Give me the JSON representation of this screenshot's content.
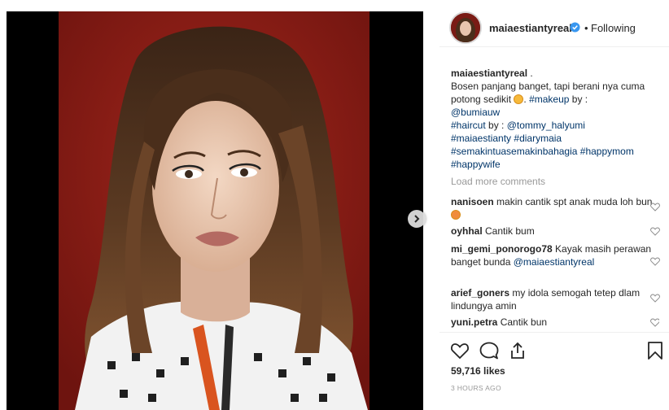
{
  "header": {
    "username": "maiaestiantyreal",
    "dot": "•",
    "follow_status": "Following"
  },
  "caption": {
    "username": "maiaestiantyreal",
    "text_1": " .",
    "line_2": "Bosen panjang banget, tapi berani nya cuma potong sedikit ",
    "line_2b": ". ",
    "tag_makeup": "#makeup",
    "by_1": " by :",
    "mention_1": "@bumiauw",
    "tag_haircut": "#haircut",
    "by_2": " by : ",
    "mention_2": "@tommy_halyumi",
    "tag_3": "#maiaestianty",
    "tag_4": "#diarymaia",
    "tag_5": "#semakintuasemakinbahagia",
    "tag_6": "#happymom",
    "tag_7": "#happywife"
  },
  "load_more": "Load more comments",
  "comments": [
    {
      "user": "nanisoen",
      "text": " makin cantik spt anak muda loh bun"
    },
    {
      "user": "oyhhal",
      "text": " Cantik bum"
    },
    {
      "user": "mi_gemi_ponorogo78",
      "text": " Kayak masih perawan banget bunda ",
      "mention": "@maiaestiantyreal"
    },
    {
      "user": "arief_goners",
      "text": " my idola semogah tetep dlam lindungya amin"
    },
    {
      "user": "yuni.petra",
      "text": " Cantik bun"
    }
  ],
  "likes": "59,716 likes",
  "time": "3 HOURS AGO",
  "icons": {
    "like": "heart-icon",
    "comment": "comment-icon",
    "share": "share-icon",
    "save": "bookmark-icon",
    "next": "chevron-right-icon",
    "verified": "verified-badge-icon"
  },
  "colors": {
    "text": "#262626",
    "link": "#003569",
    "muted": "#999999",
    "verified": "#3897f0",
    "backdrop": "#8e1d16"
  }
}
